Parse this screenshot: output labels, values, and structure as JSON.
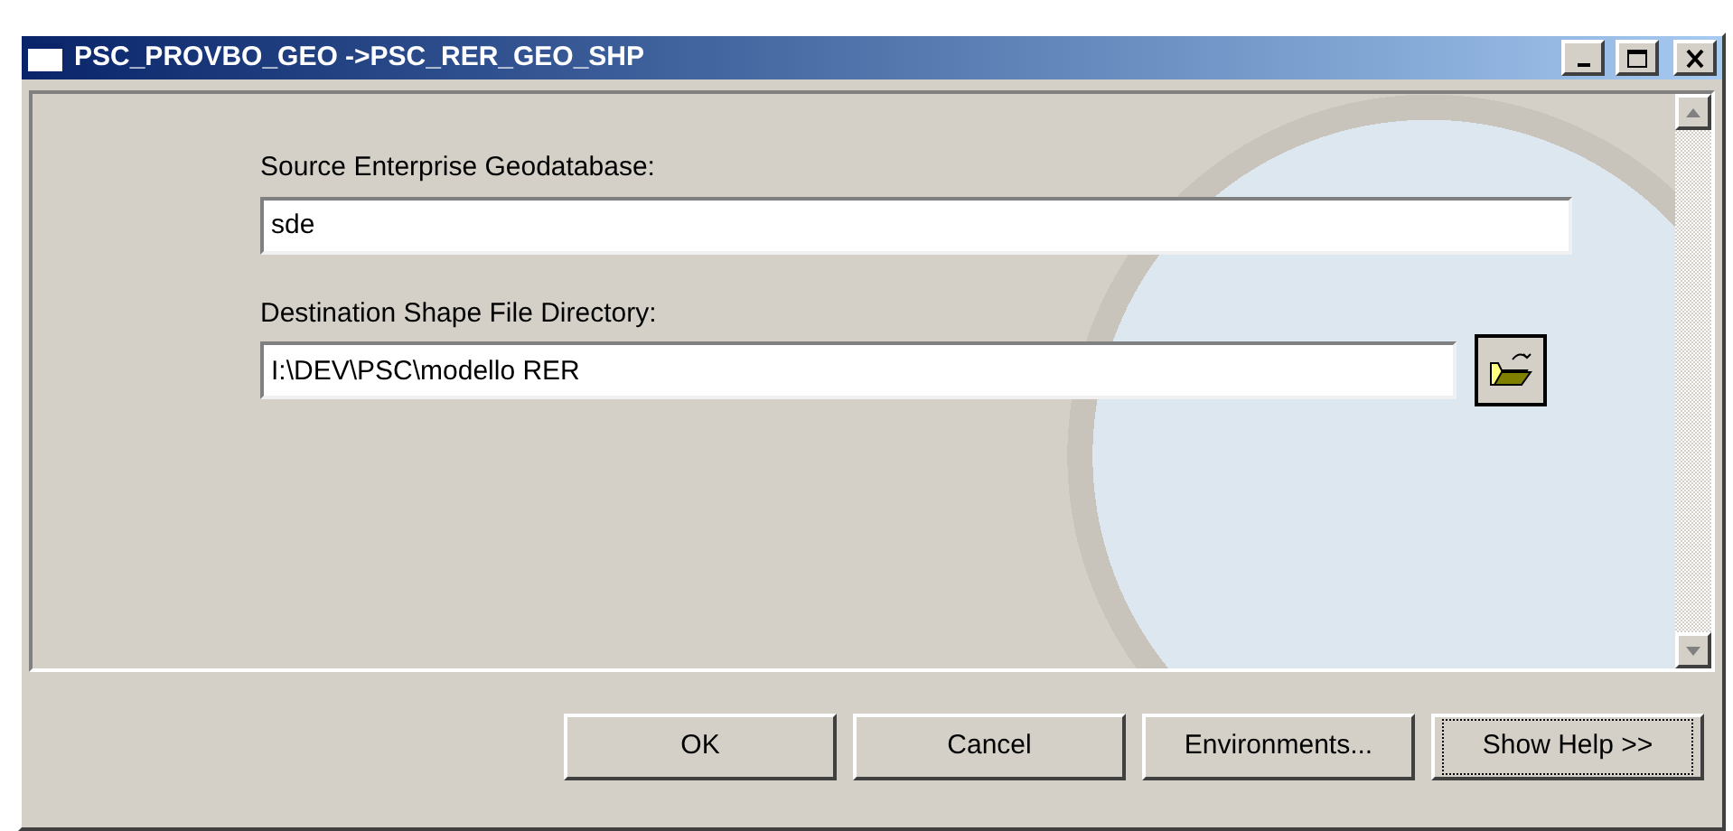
{
  "window": {
    "title": "PSC_PROVBO_GEO ->PSC_RER_GEO_SHP"
  },
  "fields": [
    {
      "label": "Source Enterprise Geodatabase:",
      "value": "sde",
      "browse": false
    },
    {
      "label": "Destination Shape File Directory:",
      "value": "I:\\DEV\\PSC\\modello RER",
      "browse": true
    }
  ],
  "buttons": [
    {
      "label": "OK",
      "focused": false
    },
    {
      "label": "Cancel",
      "focused": false
    },
    {
      "label": "Environments...",
      "focused": false
    },
    {
      "label": "Show Help >>",
      "focused": true
    }
  ]
}
